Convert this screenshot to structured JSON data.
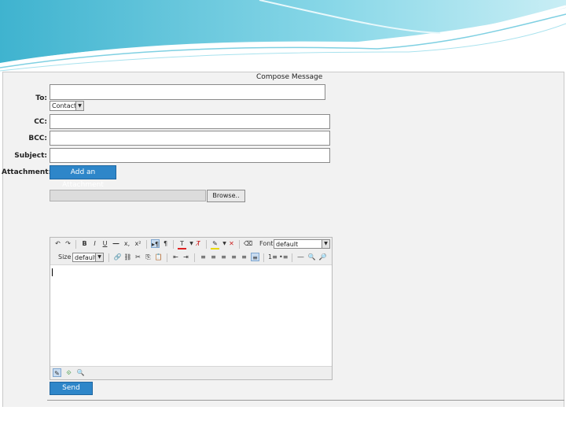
{
  "form": {
    "title": "Compose Message",
    "to_label": "To:",
    "to_value": "",
    "contacts_select": "Contacts",
    "cc_label": "CC:",
    "cc_value": "",
    "bcc_label": "BCC:",
    "bcc_value": "",
    "subject_label": "Subject:",
    "subject_value": "",
    "attachment_label": "Attachment:",
    "add_attachment_button": "Add an Attachment",
    "browse_button": "Browse..",
    "send_button": "Send"
  },
  "editor": {
    "font_label": "Font",
    "font_value": "default",
    "size_label": "Size",
    "size_value": "default",
    "body_text": "",
    "icons": {
      "undo": "↶",
      "redo": "↷",
      "bold": "B",
      "italic": "I",
      "underline": "U",
      "strike": "—",
      "subscript": "x,",
      "superscript": "x²",
      "ltr": "▸¶",
      "rtl": "¶",
      "text_color": "T",
      "remove_color": "T̸",
      "highlight": "✎",
      "remove_highlight": "✕",
      "eraser": "⌫",
      "link": "🔗",
      "unlink": "⛓",
      "cut": "✂",
      "copy": "⎘",
      "paste": "📋",
      "paste_text": "📄",
      "outdent": "⇤",
      "indent": "⇥",
      "align_left": "≡",
      "align_center": "≡",
      "align_right": "≡",
      "align_justify": "≡",
      "align_full": "≡",
      "ordered_list": "1≡",
      "unordered_list": "•≡",
      "hr": "―",
      "find": "🔍",
      "replace": "🔎",
      "design_mode": "✎",
      "html_mode": "⟐",
      "preview_mode": "🔍"
    }
  },
  "colors": {
    "accent": "#2e86c9",
    "banner_teal": "#5ec3d8",
    "panel_bg": "#f2f2f2"
  }
}
